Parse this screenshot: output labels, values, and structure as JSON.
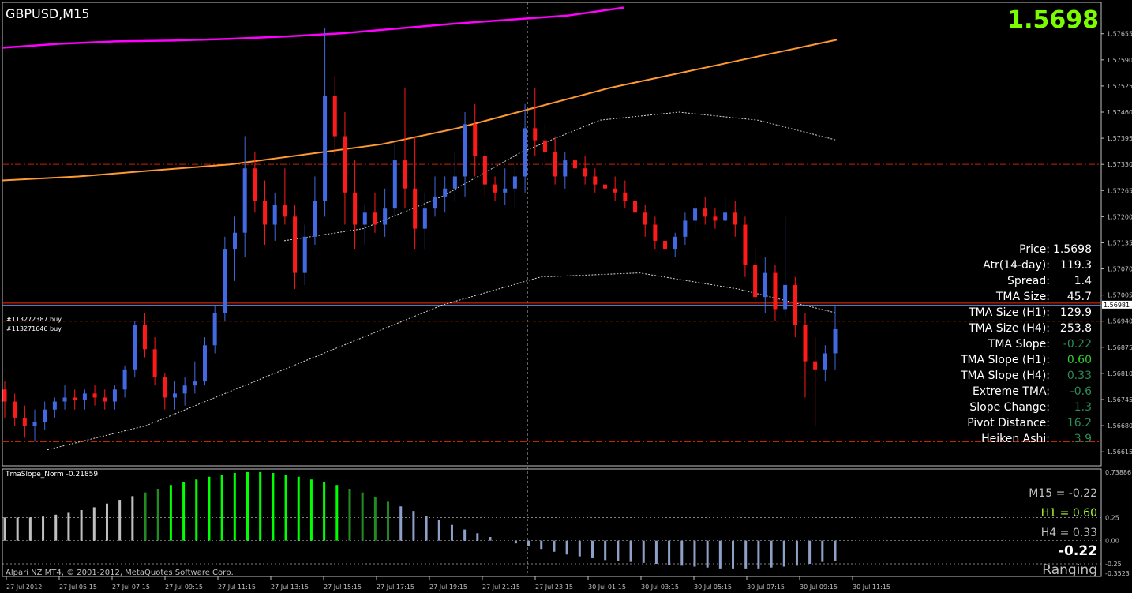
{
  "header": {
    "symbol": "GBPUSD,M15",
    "current_price": "1.5698",
    "price_color": "#7cfc00"
  },
  "orders": [
    "#113272387 buy",
    "#113271646 buy"
  ],
  "info_panel": [
    {
      "label": "Price:",
      "value": "1.5698",
      "color": "#ffffff"
    },
    {
      "label": "Atr(14-day):",
      "value": "119.3",
      "color": "#ffffff"
    },
    {
      "label": "Spread:",
      "value": "1.4",
      "color": "#ffffff"
    },
    {
      "label": "TMA Size:",
      "value": "45.7",
      "color": "#ffffff"
    },
    {
      "label": "TMA Size (H1):",
      "value": "129.9",
      "color": "#ffffff"
    },
    {
      "label": "TMA Size (H4):",
      "value": "253.8",
      "color": "#ffffff"
    },
    {
      "label": "TMA Slope:",
      "value": "-0.22",
      "color": "#2e8b57"
    },
    {
      "label": "TMA Slope (H1):",
      "value": "0.60",
      "color": "#32cd32"
    },
    {
      "label": "TMA Slope (H4):",
      "value": "0.33",
      "color": "#2e8b57"
    },
    {
      "label": "Extreme TMA:",
      "value": "-0.6",
      "color": "#2e8b57"
    },
    {
      "label": "Slope Change:",
      "value": "1.3",
      "color": "#2e8b57"
    },
    {
      "label": "Pivot Distance:",
      "value": "16.2",
      "color": "#2e8b57"
    },
    {
      "label": "Heiken Ashi:",
      "value": "3.9",
      "color": "#2e8b57"
    }
  ],
  "indicator": {
    "label": "TmaSlope_Norm -0.21859",
    "m15": "M15 = -0.22",
    "h1": "H1 = 0.60",
    "h4": "H4 = 0.33",
    "current": "-0.22",
    "state": "Ranging",
    "m15_color": "#c0c0c0",
    "h1_color": "#adff2f",
    "h4_color": "#c0c0c0",
    "axis_ticks": [
      "0.73886",
      "0.25",
      "0.00",
      "-0.25",
      "-0.3523"
    ]
  },
  "copyright": "Alpari NZ MT4, © 2001-2012, MetaQuotes Software Corp.",
  "chart_data": {
    "type": "candlestick",
    "title": "GBPUSD,M15",
    "ylim": [
      1.5658,
      1.5768
    ],
    "price_ticks": [
      "1.57655",
      "1.57590",
      "1.57525",
      "1.57460",
      "1.57395",
      "1.57330",
      "1.57265",
      "1.57200",
      "1.57135",
      "1.57070",
      "1.57005",
      "1.56940",
      "1.56875",
      "1.56810",
      "1.56745",
      "1.56680",
      "1.56615"
    ],
    "current_price_tag": "1.56981",
    "time_ticks": [
      "27 Jul 2012",
      "27 Jul 05:15",
      "27 Jul 07:15",
      "27 Jul 09:15",
      "27 Jul 11:15",
      "27 Jul 13:15",
      "27 Jul 15:15",
      "27 Jul 17:15",
      "27 Jul 19:15",
      "27 Jul 21:15",
      "27 Jul 23:15",
      "30 Jul 01:15",
      "30 Jul 03:15",
      "30 Jul 05:15",
      "30 Jul 07:15",
      "30 Jul 09:15",
      "30 Jul 11:15"
    ],
    "horizontal_levels": [
      {
        "price": 1.5733,
        "color": "#cc2200",
        "style": "dashdot"
      },
      {
        "price": 1.56985,
        "color": "#ff2a00",
        "style": "solid"
      },
      {
        "price": 1.5698,
        "color": "#6a86c8",
        "style": "solid"
      },
      {
        "price": 1.5696,
        "color": "#cc2200",
        "style": "dashed"
      },
      {
        "price": 1.5694,
        "color": "#cc2200",
        "style": "dashed"
      },
      {
        "price": 1.5664,
        "color": "#cc2200",
        "style": "dashdot"
      }
    ],
    "candles": [
      {
        "o": 1.5677,
        "h": 1.5679,
        "l": 1.567,
        "c": 1.5674
      },
      {
        "o": 1.5674,
        "h": 1.5676,
        "l": 1.5668,
        "c": 1.567
      },
      {
        "o": 1.567,
        "h": 1.5673,
        "l": 1.5665,
        "c": 1.5668
      },
      {
        "o": 1.5668,
        "h": 1.5672,
        "l": 1.5664,
        "c": 1.5669
      },
      {
        "o": 1.5669,
        "h": 1.5674,
        "l": 1.5667,
        "c": 1.5672
      },
      {
        "o": 1.5672,
        "h": 1.5675,
        "l": 1.567,
        "c": 1.5674
      },
      {
        "o": 1.5674,
        "h": 1.5678,
        "l": 1.5672,
        "c": 1.5675
      },
      {
        "o": 1.5675,
        "h": 1.5677,
        "l": 1.5672,
        "c": 1.56745
      },
      {
        "o": 1.56745,
        "h": 1.5677,
        "l": 1.5672,
        "c": 1.5676
      },
      {
        "o": 1.5676,
        "h": 1.5678,
        "l": 1.5673,
        "c": 1.5675
      },
      {
        "o": 1.5675,
        "h": 1.5677,
        "l": 1.5672,
        "c": 1.5674
      },
      {
        "o": 1.5674,
        "h": 1.5678,
        "l": 1.5672,
        "c": 1.5677
      },
      {
        "o": 1.5677,
        "h": 1.5683,
        "l": 1.5675,
        "c": 1.5682
      },
      {
        "o": 1.5682,
        "h": 1.5694,
        "l": 1.568,
        "c": 1.5693
      },
      {
        "o": 1.5693,
        "h": 1.5696,
        "l": 1.5685,
        "c": 1.5687
      },
      {
        "o": 1.5687,
        "h": 1.569,
        "l": 1.5678,
        "c": 1.568
      },
      {
        "o": 1.568,
        "h": 1.5681,
        "l": 1.5672,
        "c": 1.5675
      },
      {
        "o": 1.5675,
        "h": 1.5679,
        "l": 1.5672,
        "c": 1.5676
      },
      {
        "o": 1.5676,
        "h": 1.568,
        "l": 1.5673,
        "c": 1.5678
      },
      {
        "o": 1.5678,
        "h": 1.5684,
        "l": 1.5676,
        "c": 1.5679
      },
      {
        "o": 1.5679,
        "h": 1.569,
        "l": 1.5678,
        "c": 1.5688
      },
      {
        "o": 1.5688,
        "h": 1.5698,
        "l": 1.5686,
        "c": 1.5696
      },
      {
        "o": 1.5696,
        "h": 1.5715,
        "l": 1.5694,
        "c": 1.5712
      },
      {
        "o": 1.5712,
        "h": 1.572,
        "l": 1.5704,
        "c": 1.5716
      },
      {
        "o": 1.5716,
        "h": 1.574,
        "l": 1.571,
        "c": 1.5732
      },
      {
        "o": 1.5732,
        "h": 1.5736,
        "l": 1.5721,
        "c": 1.5724
      },
      {
        "o": 1.5724,
        "h": 1.5729,
        "l": 1.5713,
        "c": 1.5718
      },
      {
        "o": 1.5718,
        "h": 1.5726,
        "l": 1.5714,
        "c": 1.5723
      },
      {
        "o": 1.5723,
        "h": 1.5732,
        "l": 1.5718,
        "c": 1.572
      },
      {
        "o": 1.572,
        "h": 1.5723,
        "l": 1.5702,
        "c": 1.5706
      },
      {
        "o": 1.5706,
        "h": 1.5718,
        "l": 1.5703,
        "c": 1.5715
      },
      {
        "o": 1.5715,
        "h": 1.573,
        "l": 1.5713,
        "c": 1.5724
      },
      {
        "o": 1.5724,
        "h": 1.5767,
        "l": 1.572,
        "c": 1.575
      },
      {
        "o": 1.575,
        "h": 1.5755,
        "l": 1.5735,
        "c": 1.574
      },
      {
        "o": 1.574,
        "h": 1.5746,
        "l": 1.5718,
        "c": 1.5726
      },
      {
        "o": 1.5726,
        "h": 1.5734,
        "l": 1.5712,
        "c": 1.5718
      },
      {
        "o": 1.5718,
        "h": 1.5723,
        "l": 1.5713,
        "c": 1.5721
      },
      {
        "o": 1.5721,
        "h": 1.5726,
        "l": 1.5716,
        "c": 1.5718
      },
      {
        "o": 1.5718,
        "h": 1.5727,
        "l": 1.5715,
        "c": 1.5722
      },
      {
        "o": 1.5722,
        "h": 1.5738,
        "l": 1.572,
        "c": 1.5734
      },
      {
        "o": 1.5734,
        "h": 1.5752,
        "l": 1.5722,
        "c": 1.5727
      },
      {
        "o": 1.5727,
        "h": 1.574,
        "l": 1.5712,
        "c": 1.5717
      },
      {
        "o": 1.5717,
        "h": 1.5726,
        "l": 1.5712,
        "c": 1.5722
      },
      {
        "o": 1.5722,
        "h": 1.573,
        "l": 1.572,
        "c": 1.5725
      },
      {
        "o": 1.5725,
        "h": 1.573,
        "l": 1.5721,
        "c": 1.5727
      },
      {
        "o": 1.5727,
        "h": 1.5736,
        "l": 1.5724,
        "c": 1.573
      },
      {
        "o": 1.573,
        "h": 1.5746,
        "l": 1.5725,
        "c": 1.5743
      },
      {
        "o": 1.5743,
        "h": 1.5748,
        "l": 1.573,
        "c": 1.5735
      },
      {
        "o": 1.5735,
        "h": 1.5737,
        "l": 1.5725,
        "c": 1.5728
      },
      {
        "o": 1.5728,
        "h": 1.573,
        "l": 1.5724,
        "c": 1.5726
      },
      {
        "o": 1.5726,
        "h": 1.5732,
        "l": 1.5723,
        "c": 1.5727
      },
      {
        "o": 1.5727,
        "h": 1.5733,
        "l": 1.5722,
        "c": 1.573
      },
      {
        "o": 1.573,
        "h": 1.5748,
        "l": 1.5726,
        "c": 1.5742
      },
      {
        "o": 1.5742,
        "h": 1.5752,
        "l": 1.5735,
        "c": 1.5739
      },
      {
        "o": 1.5739,
        "h": 1.5743,
        "l": 1.5732,
        "c": 1.5736
      },
      {
        "o": 1.5736,
        "h": 1.574,
        "l": 1.5728,
        "c": 1.573
      },
      {
        "o": 1.573,
        "h": 1.5736,
        "l": 1.5727,
        "c": 1.5734
      },
      {
        "o": 1.5734,
        "h": 1.5738,
        "l": 1.573,
        "c": 1.5732
      },
      {
        "o": 1.5732,
        "h": 1.5735,
        "l": 1.5728,
        "c": 1.573
      },
      {
        "o": 1.573,
        "h": 1.5732,
        "l": 1.5726,
        "c": 1.5728
      },
      {
        "o": 1.5728,
        "h": 1.5731,
        "l": 1.5725,
        "c": 1.5727
      },
      {
        "o": 1.5727,
        "h": 1.573,
        "l": 1.5724,
        "c": 1.5726
      },
      {
        "o": 1.5726,
        "h": 1.5729,
        "l": 1.5722,
        "c": 1.5724
      },
      {
        "o": 1.5724,
        "h": 1.5727,
        "l": 1.5719,
        "c": 1.5721
      },
      {
        "o": 1.5721,
        "h": 1.5723,
        "l": 1.5715,
        "c": 1.5718
      },
      {
        "o": 1.5718,
        "h": 1.572,
        "l": 1.5712,
        "c": 1.5714
      },
      {
        "o": 1.5714,
        "h": 1.5716,
        "l": 1.571,
        "c": 1.5712
      },
      {
        "o": 1.5712,
        "h": 1.5716,
        "l": 1.571,
        "c": 1.5715
      },
      {
        "o": 1.5715,
        "h": 1.5721,
        "l": 1.5713,
        "c": 1.5719
      },
      {
        "o": 1.5719,
        "h": 1.5724,
        "l": 1.5716,
        "c": 1.5722
      },
      {
        "o": 1.5722,
        "h": 1.5725,
        "l": 1.5718,
        "c": 1.572
      },
      {
        "o": 1.572,
        "h": 1.5722,
        "l": 1.5717,
        "c": 1.5719
      },
      {
        "o": 1.5719,
        "h": 1.5725,
        "l": 1.5717,
        "c": 1.5721
      },
      {
        "o": 1.5721,
        "h": 1.5724,
        "l": 1.5715,
        "c": 1.5718
      },
      {
        "o": 1.5718,
        "h": 1.572,
        "l": 1.5705,
        "c": 1.5708
      },
      {
        "o": 1.5708,
        "h": 1.5712,
        "l": 1.5698,
        "c": 1.57
      },
      {
        "o": 1.57,
        "h": 1.571,
        "l": 1.5696,
        "c": 1.5706
      },
      {
        "o": 1.5706,
        "h": 1.5708,
        "l": 1.5694,
        "c": 1.5697
      },
      {
        "o": 1.5697,
        "h": 1.572,
        "l": 1.5695,
        "c": 1.5703
      },
      {
        "o": 1.5703,
        "h": 1.5705,
        "l": 1.569,
        "c": 1.5693
      },
      {
        "o": 1.5693,
        "h": 1.5696,
        "l": 1.5675,
        "c": 1.5684
      },
      {
        "o": 1.5684,
        "h": 1.569,
        "l": 1.5668,
        "c": 1.5682
      },
      {
        "o": 1.5682,
        "h": 1.5688,
        "l": 1.5679,
        "c": 1.5686
      },
      {
        "o": 1.5686,
        "h": 1.5698,
        "l": 1.5682,
        "c": 1.5692
      }
    ],
    "series": [
      {
        "values": [
          1.5762,
          1.5763,
          1.57636,
          1.57638,
          1.57642,
          1.57648,
          1.57656,
          1.57668,
          1.5768,
          1.5769,
          1.577,
          1.5772
        ]
      },
      {
        "values": [
          1.5729,
          1.573,
          1.57315,
          1.5733,
          1.57355,
          1.5738,
          1.5742,
          1.5747,
          1.5752,
          1.5756,
          1.576,
          1.5764
        ]
      },
      {
        "values": [
          1.5714,
          1.5717,
          1.5725,
          1.5736,
          1.5744,
          1.5746,
          1.5744,
          1.5739
        ]
      },
      {
        "values": [
          1.5662,
          1.5668,
          1.5678,
          1.5688,
          1.5698,
          1.5705,
          1.5706,
          1.5702,
          1.5696
        ]
      }
    ],
    "indicator_values": [
      0.25,
      0.25,
      0.25,
      0.26,
      0.28,
      0.3,
      0.33,
      0.36,
      0.4,
      0.44,
      0.48,
      0.52,
      0.56,
      0.6,
      0.63,
      0.66,
      0.69,
      0.71,
      0.73,
      0.74,
      0.74,
      0.73,
      0.71,
      0.69,
      0.66,
      0.63,
      0.6,
      0.56,
      0.52,
      0.47,
      0.42,
      0.37,
      0.32,
      0.27,
      0.22,
      0.17,
      0.12,
      0.08,
      0.04,
      0.0,
      -0.03,
      -0.06,
      -0.09,
      -0.12,
      -0.15,
      -0.17,
      -0.19,
      -0.21,
      -0.22,
      -0.23,
      -0.24,
      -0.25,
      -0.26,
      -0.27,
      -0.28,
      -0.29,
      -0.3,
      -0.3,
      -0.3,
      -0.3,
      -0.29,
      -0.28,
      -0.27,
      -0.25,
      -0.23,
      -0.22
    ],
    "indicator_colors": [
      "#c0c0c0",
      "#00ff00",
      "#228b22",
      "#8fa0c8"
    ]
  }
}
